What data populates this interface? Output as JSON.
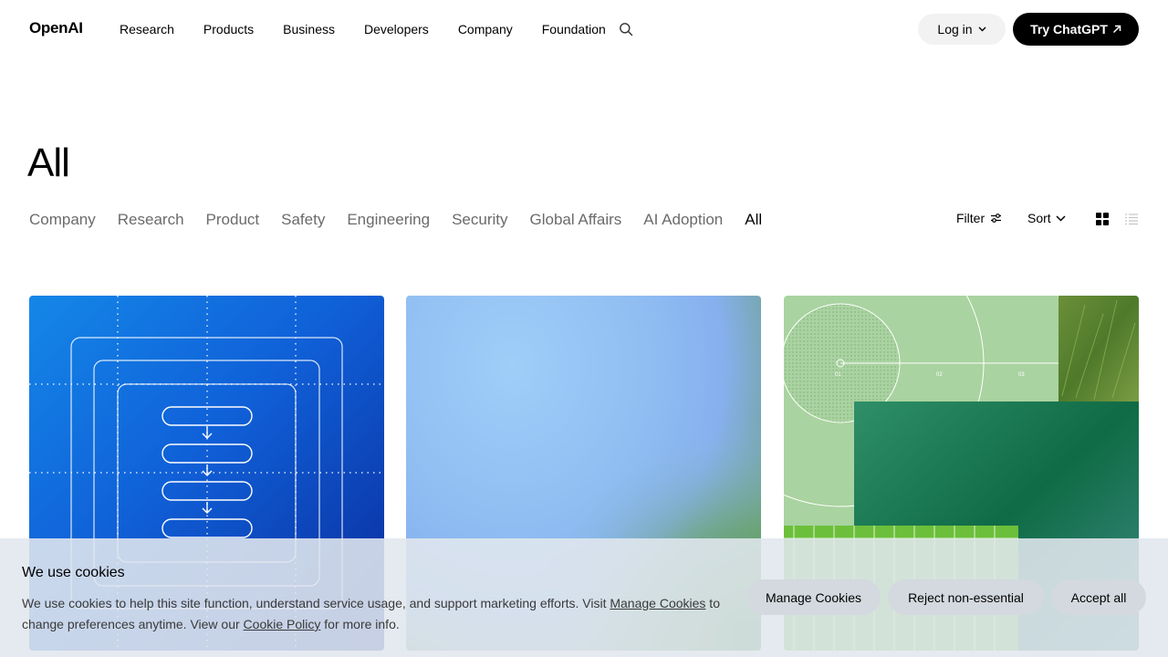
{
  "header": {
    "logo": "OpenAI",
    "nav": [
      "Research",
      "Products",
      "Business",
      "Developers",
      "Company",
      "Foundation"
    ],
    "login_label": "Log in",
    "try_label": "Try ChatGPT"
  },
  "page": {
    "title": "All",
    "tabs": [
      "Company",
      "Research",
      "Product",
      "Safety",
      "Engineering",
      "Security",
      "Global Affairs",
      "AI Adoption",
      "All"
    ],
    "active_tab": "All",
    "filter_label": "Filter",
    "sort_label": "Sort",
    "view_mode": "grid"
  },
  "cards": [
    {
      "theme": "blue flowchart illustration",
      "color": "#1060d8"
    },
    {
      "theme": "soft blue-green gradient",
      "color": "#8fbdf2"
    },
    {
      "theme": "green collage",
      "color": "#a9d3a0",
      "labels": [
        "01",
        "02",
        "03"
      ]
    }
  ],
  "cookie": {
    "title": "We use cookies",
    "text_1": "We use cookies to help this site function, understand service usage, and support marketing efforts. Visit ",
    "link_1": "Manage Cookies",
    "text_2": " to change preferences anytime. View our ",
    "link_2": "Cookie Policy",
    "text_3": " for more info.",
    "manage_label": "Manage Cookies",
    "reject_label": "Reject non-essential",
    "accept_label": "Accept all"
  }
}
